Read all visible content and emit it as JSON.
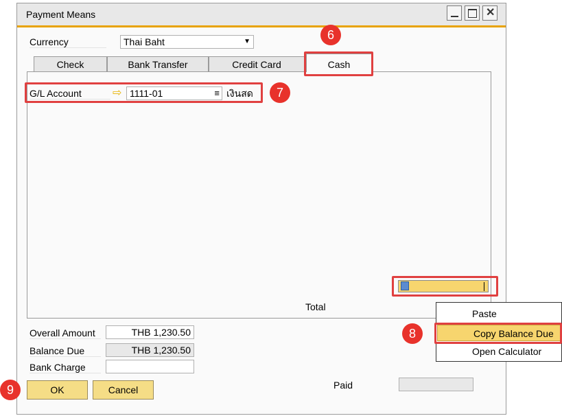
{
  "window": {
    "title": "Payment Means"
  },
  "currency": {
    "label": "Currency",
    "value": "Thai Baht"
  },
  "tabs": [
    {
      "label": "Check"
    },
    {
      "label": "Bank Transfer"
    },
    {
      "label": "Credit Card"
    },
    {
      "label": "Cash"
    }
  ],
  "cash": {
    "gl_label": "G/L Account",
    "gl_value": "1111-01",
    "gl_name": "เงินสด",
    "total_label": "Total",
    "total_value": ""
  },
  "summary": {
    "overall_label": "Overall Amount",
    "overall_value": "THB 1,230.50",
    "balance_label": "Balance Due",
    "balance_value": "THB 1,230.50",
    "charge_label": "Bank Charge",
    "charge_value": "",
    "paid_label": "Paid",
    "paid_value": ""
  },
  "buttons": {
    "ok": "OK",
    "cancel": "Cancel"
  },
  "context_menu": {
    "items": [
      {
        "label": "Paste"
      },
      {
        "label": "Copy Balance Due"
      },
      {
        "label": "Open Calculator"
      }
    ]
  },
  "callouts": [
    "6",
    "7",
    "8",
    "9"
  ],
  "colors": {
    "accent": "#e8a300",
    "button": "#f5dd86",
    "highlight": "#f7d56e",
    "callout": "#e8322b"
  }
}
